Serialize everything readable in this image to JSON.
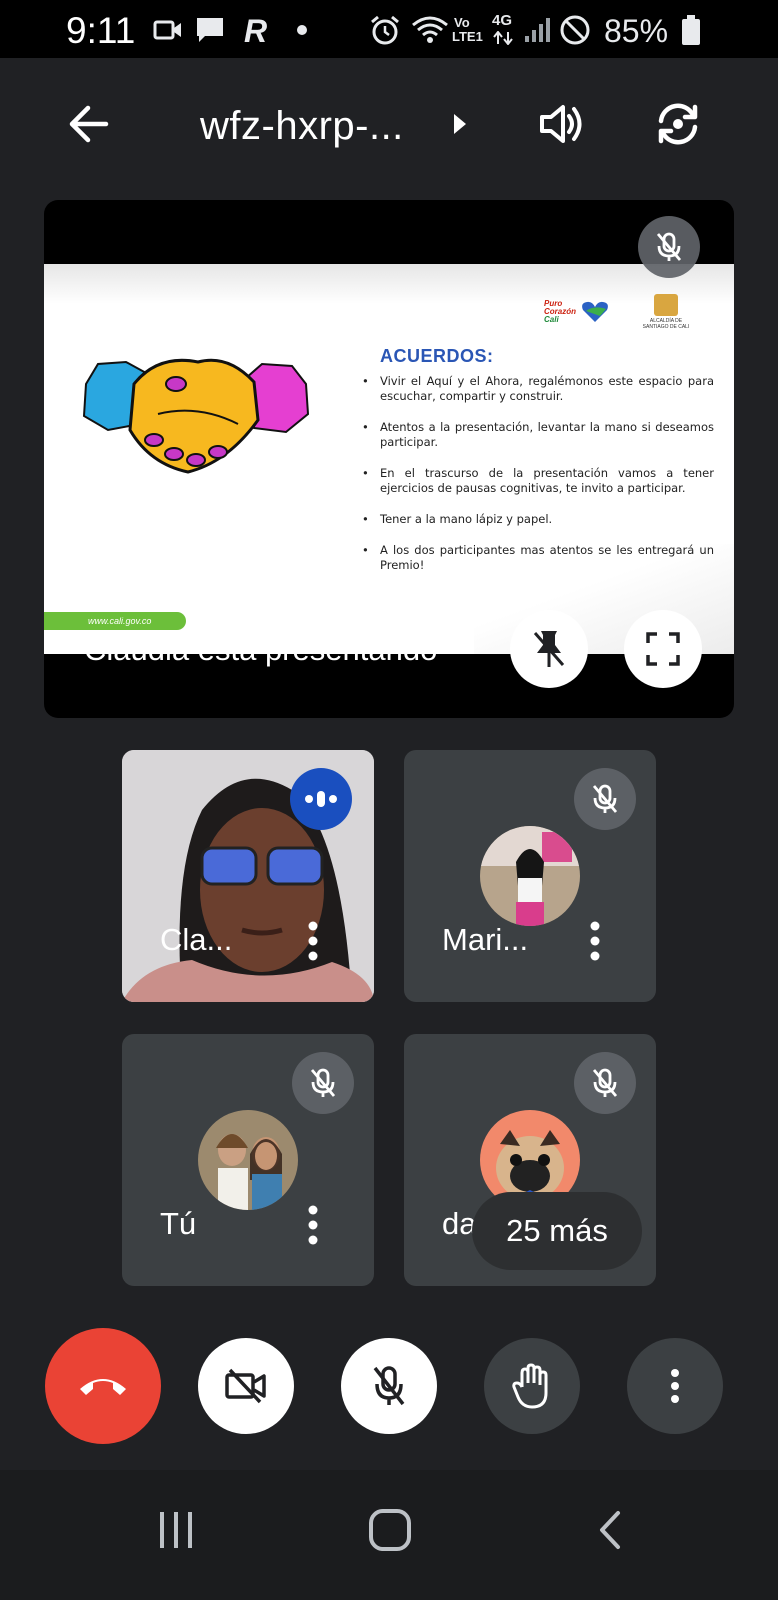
{
  "status_bar": {
    "time": "9:11",
    "battery": "85%",
    "network_top": "Vo",
    "network_bottom": "LTE1",
    "network_gen": "4G",
    "app_letter": "R"
  },
  "header": {
    "meeting_code": "wfz-hxrp-..."
  },
  "presentation": {
    "slide": {
      "heading": "ACUERDOS:",
      "bullets": [
        "Vivir el Aquí y el Ahora, regalémonos este espacio para escuchar, compartir y construir.",
        "Atentos a la presentación, levantar la mano si deseamos participar.",
        "En el trascurso de la presentación vamos a tener ejercicios de pausas cognitivas, te invito a participar.",
        "Tener a la mano lápiz y papel.",
        "A los dos participantes mas atentos se les entregará un Premio!"
      ],
      "link": "www.cali.gov.co",
      "logo_line1": "Puro",
      "logo_line2": "Corazón",
      "logo_line3": "Cali",
      "alcaldia_line1": "ALCALDÍA DE",
      "alcaldia_line2": "SANTIAGO DE CALI"
    },
    "presenter_label": "Claudia está presentando"
  },
  "participants": [
    {
      "name": "Cla...",
      "muted": false,
      "speaking": true
    },
    {
      "name": "Mari...",
      "muted": true
    },
    {
      "name": "Tú",
      "muted": true
    },
    {
      "name": "davi",
      "muted": true
    }
  ],
  "more_participants": "25 más",
  "colors": {
    "background": "#202124",
    "tile": "#3c4043",
    "end_call": "#ea4335",
    "speaking": "#1a4fbf"
  }
}
